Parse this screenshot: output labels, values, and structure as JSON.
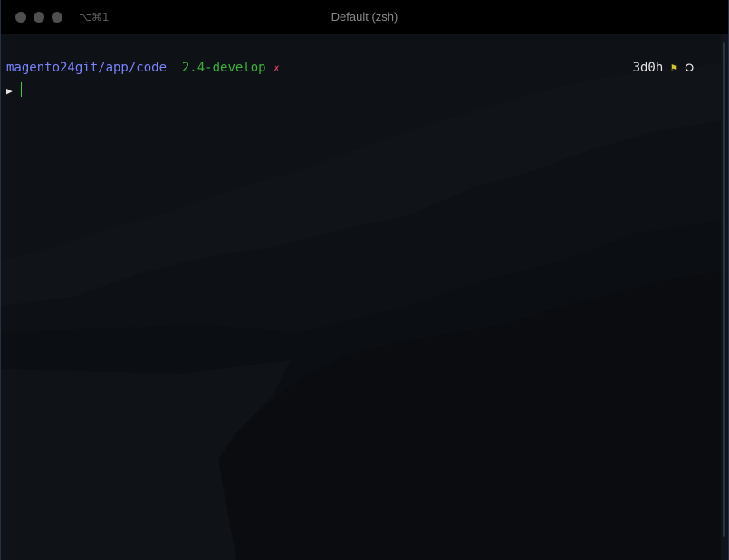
{
  "window": {
    "title": "Default (zsh)",
    "shortcut": "⌥⌘1"
  },
  "prompt": {
    "path": "magento24git/app/code",
    "branch": "2.4-develop",
    "dirty_marker": "✗",
    "prompt_symbol": "▶",
    "right": {
      "time": "3d0h",
      "flag_icon": "flag-icon",
      "flag_glyph": "⚑",
      "bell_icon": "bell-icon",
      "bell_glyph": "⭘"
    }
  },
  "colors": {
    "path": "#7a84ff",
    "branch": "#3bb33b",
    "dirty": "#d9455f",
    "flag": "#d6c42a",
    "cursor": "#3ccd3c"
  }
}
